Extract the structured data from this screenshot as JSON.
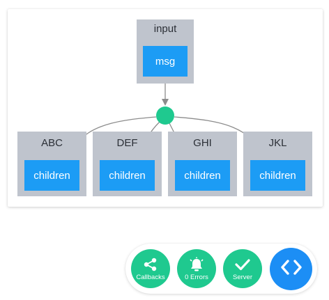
{
  "colors": {
    "cluster": "#bfc4cd",
    "node": "#1c9cf5",
    "hub": "#1fc98f",
    "edge": "#8c8c8c",
    "dock_green": "#1fc98f",
    "dock_blue": "#1c8ef5"
  },
  "graph": {
    "input_cluster": {
      "label": "input",
      "node": "msg"
    },
    "hub_icon": "circle-node",
    "output_clusters": [
      {
        "label": "ABC",
        "node": "children"
      },
      {
        "label": "DEF",
        "node": "children"
      },
      {
        "label": "GHI",
        "node": "children"
      },
      {
        "label": "JKL",
        "node": "children"
      }
    ]
  },
  "dock": {
    "callbacks": {
      "label": "Callbacks",
      "icon": "share-icon"
    },
    "errors": {
      "label": "0 Errors",
      "icon": "bell-icon"
    },
    "server": {
      "label": "Server",
      "icon": "check-icon"
    },
    "code": {
      "icon": "code-brackets-icon"
    }
  }
}
